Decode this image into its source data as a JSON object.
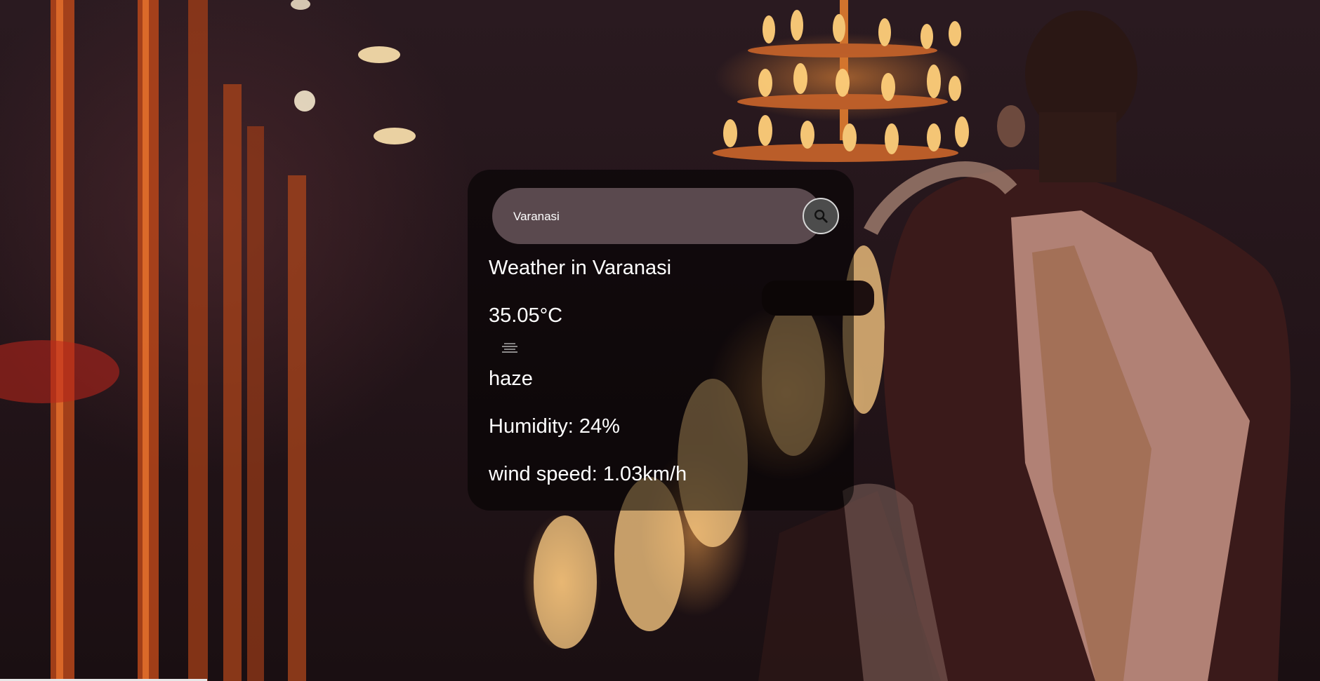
{
  "search": {
    "value": "Varanasi",
    "placeholder": "Search"
  },
  "weather": {
    "city_heading": "Weather in Varanasi",
    "temperature": "35.05°C",
    "icon": "haze-icon",
    "description": "haze",
    "humidity": "Humidity: 24%",
    "wind_speed": "wind speed: 1.03km/h"
  },
  "colors": {
    "card_background": "#000000",
    "search_background": "#735f64",
    "search_button": "#4c4c4c",
    "text": "#ffffff"
  }
}
